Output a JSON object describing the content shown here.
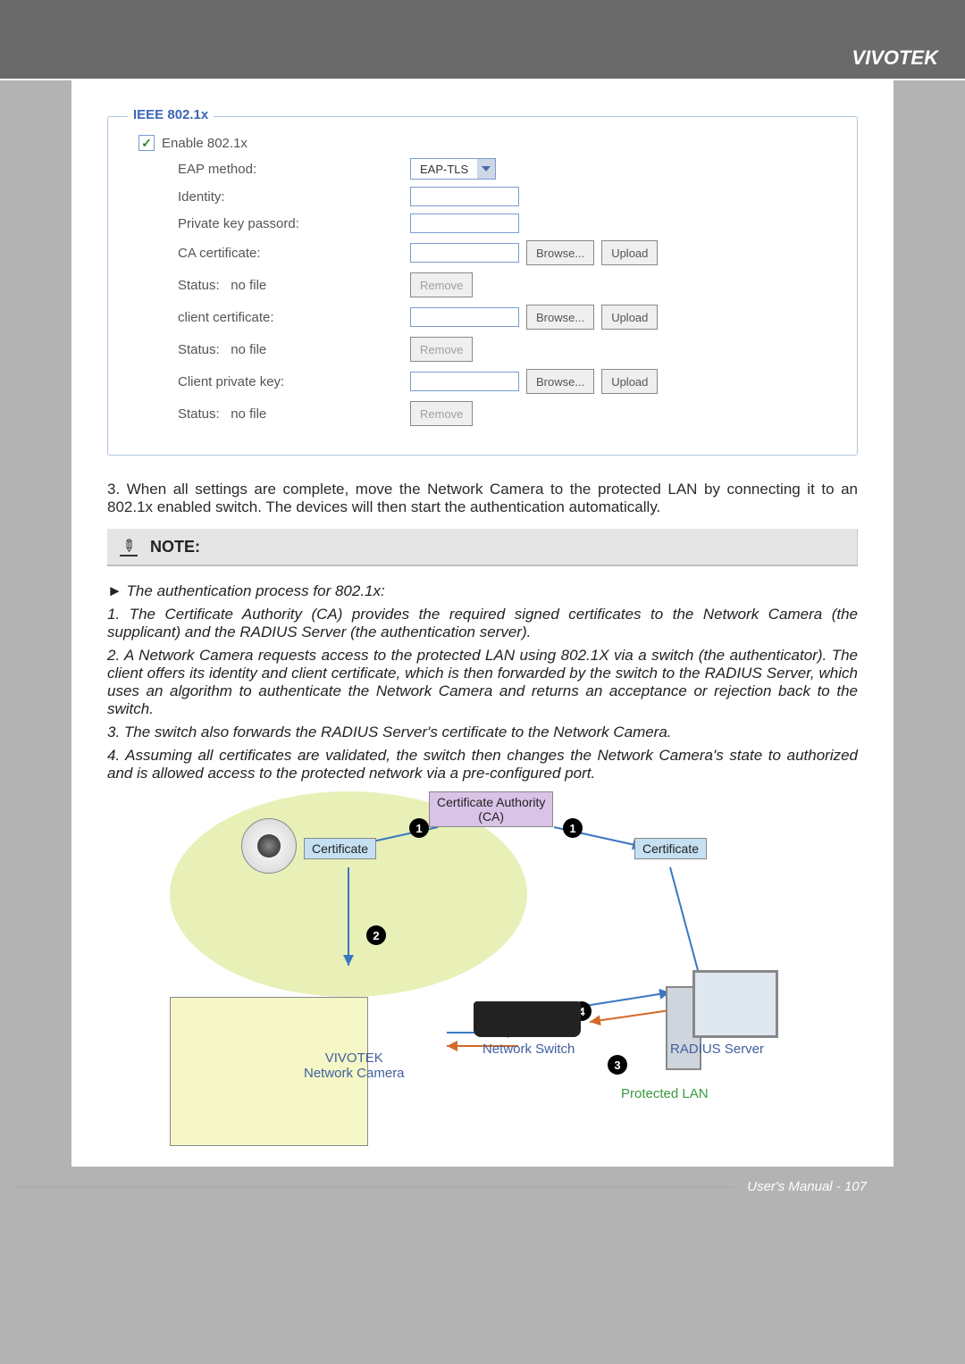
{
  "brand": "VIVOTEK",
  "footer": "User's Manual - 107",
  "panel": {
    "legend": "IEEE 802.1x",
    "enable_label": "Enable 802.1x",
    "enable_checked": "✓",
    "eap_label": "EAP method:",
    "eap_value": "EAP-TLS",
    "identity_label": "Identity:",
    "pkpass_label": "Private key passord:",
    "ca": {
      "label": "CA certificate:",
      "status_label": "Status:",
      "status_value": "no file",
      "browse": "Browse...",
      "upload": "Upload",
      "remove": "Remove"
    },
    "cc": {
      "label": "client certificate:",
      "status_label": "Status:",
      "status_value": "no file",
      "browse": "Browse...",
      "upload": "Upload",
      "remove": "Remove"
    },
    "cpk": {
      "label": "Client private key:",
      "status_label": "Status:",
      "status_value": "no file",
      "browse": "Browse...",
      "upload": "Upload",
      "remove": "Remove"
    }
  },
  "step3": "3. When all settings are complete, move the Network Camera to the protected LAN by connecting it to an 802.1x enabled switch. The devices will then start the authentication automatically.",
  "note_heading": "NOTE:",
  "process": {
    "intro": "► The authentication process for 802.1x:",
    "p1": "1. The Certificate Authority (CA) provides the required signed certificates to the Network Camera (the supplicant) and the RADIUS Server (the authentication server).",
    "p2": "2. A Network Camera requests access to the protected LAN using 802.1X via a switch (the authenticator). The client offers its identity and client certificate, which is then forwarded by the switch to the RADIUS Server, which uses an algorithm to authenticate the Network Camera and returns an acceptance or rejection back to the switch.",
    "p3": "3. The switch also forwards the RADIUS Server's certificate to the Network Camera.",
    "p4": "4. Assuming all certificates are validated, the switch then changes the Network Camera's state to authorized and is allowed access to the protected network via a pre-configured port."
  },
  "diagram": {
    "ca": "Certificate Authority\n(CA)",
    "cert": "Certificate",
    "camera": "VIVOTEK\nNetwork Camera",
    "switch": "Network Switch",
    "radius": "RADIUS Server",
    "lan": "Protected LAN",
    "s1": "1",
    "s2": "2",
    "s3": "3",
    "s4": "4"
  }
}
